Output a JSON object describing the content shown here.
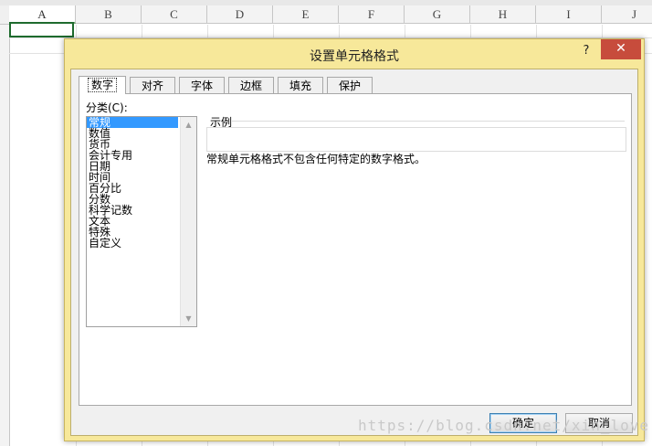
{
  "spreadsheet": {
    "columns": [
      "A",
      "B",
      "C",
      "D",
      "E",
      "F",
      "G",
      "H",
      "I",
      "J"
    ],
    "selected_column": "A",
    "watermark": "https://blog.csdn.net/xin_love"
  },
  "dialog": {
    "title": "设置单元格格式",
    "help_label": "?",
    "close_label": "✕",
    "tabs": [
      {
        "label": "数字",
        "active": true
      },
      {
        "label": "对齐",
        "active": false
      },
      {
        "label": "字体",
        "active": false
      },
      {
        "label": "边框",
        "active": false
      },
      {
        "label": "填充",
        "active": false
      },
      {
        "label": "保护",
        "active": false
      }
    ],
    "category_label": "分类(C):",
    "categories": [
      "常规",
      "数值",
      "货币",
      "会计专用",
      "日期",
      "时间",
      "百分比",
      "分数",
      "科学记数",
      "文本",
      "特殊",
      "自定义"
    ],
    "selected_category": "常规",
    "sample_label": "示例",
    "description": "常规单元格格式不包含任何特定的数字格式。",
    "ok_label": "确定",
    "cancel_label": "取消"
  },
  "colors": {
    "dialog_frame": "#f7e89a",
    "close_button": "#c74c3c",
    "selection": "#3399ff",
    "active_cell_border": "#1e6b2e"
  }
}
